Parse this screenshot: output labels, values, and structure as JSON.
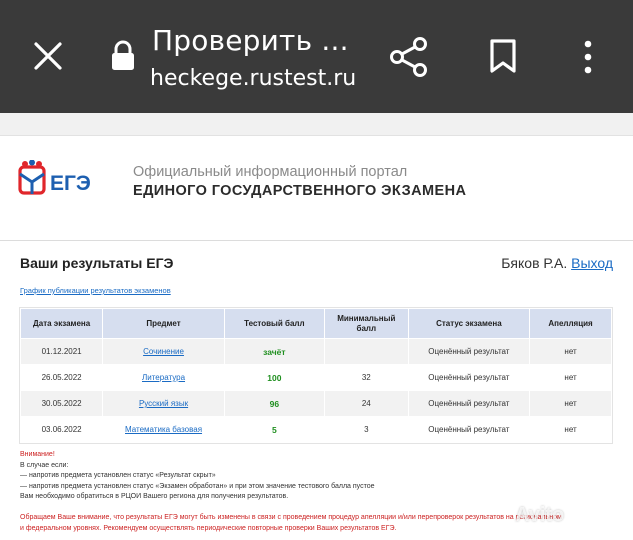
{
  "browser": {
    "title": "Проверить ...",
    "url": "heckege.rustest.ru"
  },
  "portal": {
    "logo_text": "ЕГЭ",
    "subtitle": "Официальный информационный портал",
    "title": "ЕДИНОГО ГОСУДАРСТВЕННОГО ЭКЗАМЕНА"
  },
  "page": {
    "results_title": "Ваши результаты ЕГЭ",
    "user_name": "Бяков Р.А.",
    "logout_label": "Выход",
    "schedule_link": "График публикации результатов экзаменов"
  },
  "table": {
    "headers": {
      "date": "Дата экзамена",
      "subject": "Предмет",
      "score": "Тестовый балл",
      "min_score": "Минимальный балл",
      "status": "Статус экзамена",
      "appeal": "Апелляция"
    },
    "rows": [
      {
        "date": "01.12.2021",
        "subject": "Сочинение",
        "score": "зачёт",
        "min": "",
        "status": "Оценённый результат",
        "appeal": "нет"
      },
      {
        "date": "26.05.2022",
        "subject": "Литература",
        "score": "100",
        "min": "32",
        "status": "Оценённый результат",
        "appeal": "нет"
      },
      {
        "date": "30.05.2022",
        "subject": "Русский язык",
        "score": "96",
        "min": "24",
        "status": "Оценённый результат",
        "appeal": "нет"
      },
      {
        "date": "03.06.2022",
        "subject": "Математика базовая",
        "score": "5",
        "min": "3",
        "status": "Оценённый результат",
        "appeal": "нет"
      }
    ]
  },
  "notes": {
    "warning": "Внимание!",
    "line1": "В случае если:",
    "line2": "— напротив предмета установлен статус «Результат скрыт»",
    "line3": "— напротив предмета установлен статус «Экзамен обработан» и при этом значение тестового балла пустое",
    "line4": "Вам необходимо обратиться в РЦОИ Вашего региона для получения результатов.",
    "notice1": "Обращаем Ваше внимание, что результаты ЕГЭ могут быть изменены в связи с проведением процедур апелляции и/или перепроверок результатов на региональном",
    "notice2": "и федеральном уровнях. Рекомендуем осуществлять периодические повторные проверки Ваших результатов ЕГЭ."
  },
  "watermark": "Avito",
  "colors": {
    "topbar": "#3a3a3a",
    "link": "#1a6bc4",
    "header_row": "#d6deef",
    "score_green": "#1f8f1f",
    "warning_red": "#cc2222",
    "logo_red": "#e0262b",
    "logo_blue": "#1d5fb0"
  },
  "icons": [
    "close-icon",
    "lock-icon",
    "share-icon",
    "bookmark-icon",
    "more-vert-icon",
    "ege-logo"
  ]
}
